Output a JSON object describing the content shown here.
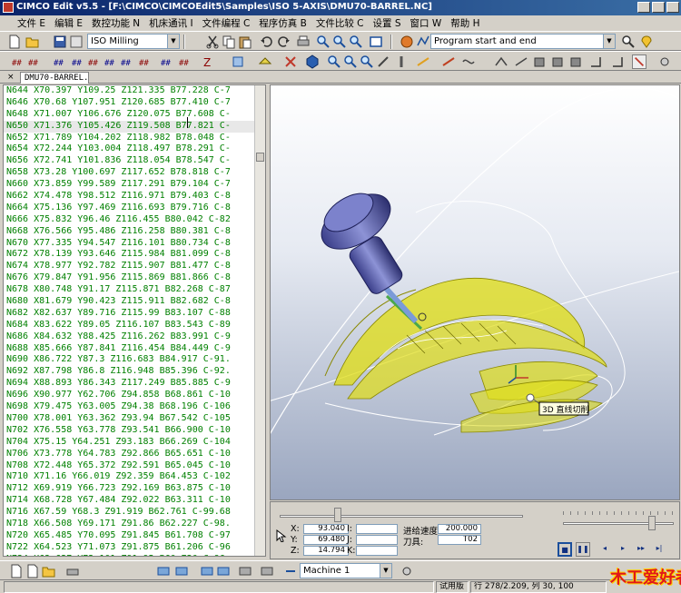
{
  "window": {
    "title": "CIMCO Edit v5.5 - [F:\\CIMCO\\CIMCOEdit5\\Samples\\ISO 5-AXIS\\DMU70-BARREL.NC]"
  },
  "menu": [
    "文件 E",
    "编辑 E",
    "数控功能 N",
    "机床通讯 I",
    "文件编程 C",
    "程序仿真 B",
    "文件比较 C",
    "设置 S",
    "窗口 W",
    "帮助 H"
  ],
  "toolbar": {
    "machine_type": "ISO Milling",
    "tool_path_select": "Program start and end",
    "machine_select": "Machine 1"
  },
  "file_tab": {
    "name": "DMU70-BARREL.NC",
    "close": "×"
  },
  "code_lines": [
    "N644 X70.397 Y109.25 Z121.335 B77.228 C-7",
    "N646 X70.68 Y107.951 Z120.685 B77.410 C-7",
    "N648 X71.007 Y106.676 Z120.075 B77.608 C-",
    "N650 X71.376 Y105.426 Z119.508 B77.821 C-",
    "N652 X71.789 Y104.202 Z118.982 B78.048 C-",
    "N654 X72.244 Y103.004 Z118.497 B78.291 C-",
    "N656 X72.741 Y101.836 Z118.054 B78.547 C-",
    "N658 X73.28 Y100.697 Z117.652 B78.818 C-7",
    "N660 X73.859 Y99.589 Z117.291 B79.104 C-7",
    "N662 X74.478 Y98.512 Z116.971 B79.403 C-8",
    "N664 X75.136 Y97.469 Z116.693 B79.716 C-8",
    "N666 X75.832 Y96.46 Z116.455 B80.042 C-82",
    "N668 X76.566 Y95.486 Z116.258 B80.381 C-8",
    "N670 X77.335 Y94.547 Z116.101 B80.734 C-8",
    "N672 X78.139 Y93.646 Z115.984 B81.099 C-8",
    "N674 X78.977 Y92.782 Z115.907 B81.477 C-8",
    "N676 X79.847 Y91.956 Z115.869 B81.866 C-8",
    "N678 X80.748 Y91.17 Z115.871 B82.268 C-87",
    "N680 X81.679 Y90.423 Z115.911 B82.682 C-8",
    "N682 X82.637 Y89.716 Z115.99 B83.107 C-88",
    "N684 X83.622 Y89.05 Z116.107 B83.543 C-89",
    "N686 X84.632 Y88.425 Z116.262 B83.991 C-9",
    "N688 X85.666 Y87.841 Z116.454 B84.449 C-9",
    "N690 X86.722 Y87.3 Z116.683 B84.917 C-91.",
    "N692 X87.798 Y86.8 Z116.948 B85.396 C-92.",
    "N694 X88.893 Y86.343 Z117.249 B85.885 C-9",
    "N696 X90.977 Y62.706 Z94.858 B68.861 C-10",
    "N698 X79.475 Y63.005 Z94.38 B68.196 C-106",
    "N700 X78.001 Y63.362 Z93.94 B67.542 C-105",
    "N702 X76.558 Y63.778 Z93.541 B66.900 C-10",
    "N704 X75.15 Y64.251 Z93.183 B66.269 C-104",
    "N706 X73.778 Y64.783 Z92.866 B65.651 C-10",
    "N708 X72.448 Y65.372 Z92.591 B65.045 C-10",
    "N710 X71.16 Y66.019 Z92.359 B64.453 C-102",
    "N712 X69.919 Y66.723 Z92.169 B63.875 C-10",
    "N714 X68.728 Y67.484 Z92.022 B63.311 C-10",
    "N716 X67.59 Y68.3 Z91.919 B62.761 C-99.68",
    "N718 X66.508 Y69.171 Z91.86 B62.227 C-98.",
    "N720 X65.485 Y70.095 Z91.845 B61.708 C-97",
    "N722 X64.523 Y71.073 Z91.875 B61.206 C-96",
    "N724 X63.627 Y72.101 Z91.95 B60.720 C-96.",
    "N726 X62.798 Y73.18 Z92.071 B60.252 C-95.",
    "N728 X62.04 Y74.307 Z92.238 B59.801 C-94."
  ],
  "viewport": {
    "tooltip": "3D 直线切削"
  },
  "sim_panel": {
    "x_label": "X:",
    "x_value": "93.040",
    "y_label": "Y:",
    "y_value": "69.480",
    "z_label": "Z:",
    "z_value": "14.794",
    "i_label": "I:",
    "j_label": "J:",
    "k_label": "K:",
    "feed_label": "进给速度:",
    "feed_value": "200.000",
    "tool_label": "刀具:",
    "tool_value": "T02"
  },
  "status": {
    "mode": "试用版",
    "position": "行 278/2.209, 列 30, 100",
    "logo_text": "木工爱好者"
  },
  "colors": {
    "code_text": "#008000",
    "toolpath": "#d6d400",
    "title_bar": "#0a246a"
  }
}
